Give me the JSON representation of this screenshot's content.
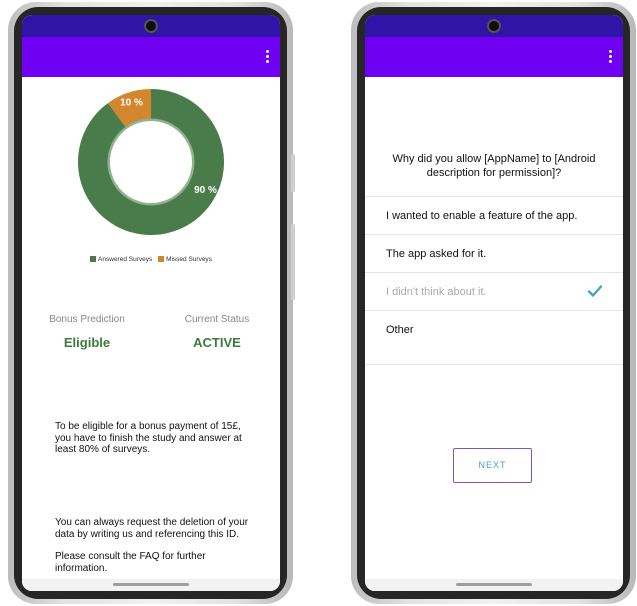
{
  "left_screen": {
    "chart_data": {
      "type": "pie",
      "categories": [
        "Answered Surveys",
        "Missed Surveys"
      ],
      "values": [
        90,
        10
      ],
      "data_labels": [
        "90 %",
        "10 %"
      ],
      "colors": [
        "#4a7c4b",
        "#d4862f"
      ],
      "legend_placement": "bottom"
    },
    "bonus_prediction": {
      "label": "Bonus Prediction",
      "value": "Eligible"
    },
    "current_status": {
      "label": "Current Status",
      "value": "ACTIVE"
    },
    "eligibility_text": "To be eligible for a bonus payment of 15£, you have to finish the study and answer at least 80% of surveys.",
    "deletion_text": "You can always request the deletion of your data by writing us and referencing this ID.",
    "faq_text": "Please consult the FAQ for further information.",
    "menu_icon": "more-vert-icon"
  },
  "right_screen": {
    "question": "Why did you allow [AppName] to [Android description for permission]?",
    "options": [
      {
        "label": "I wanted to enable a feature of the app.",
        "selected": false
      },
      {
        "label": "The app asked for it.",
        "selected": false
      },
      {
        "label": "I didn't think about it.",
        "selected": true
      },
      {
        "label": "Other",
        "selected": false
      }
    ],
    "next_button": "NEXT",
    "selected_icon": "check-icon",
    "menu_icon": "more-vert-icon"
  },
  "colors": {
    "app_bar": "#6f00f2",
    "status_bar": "#2f14a8",
    "accent_green": "#3a7d3a",
    "accent_blue": "#4a9ec7"
  }
}
